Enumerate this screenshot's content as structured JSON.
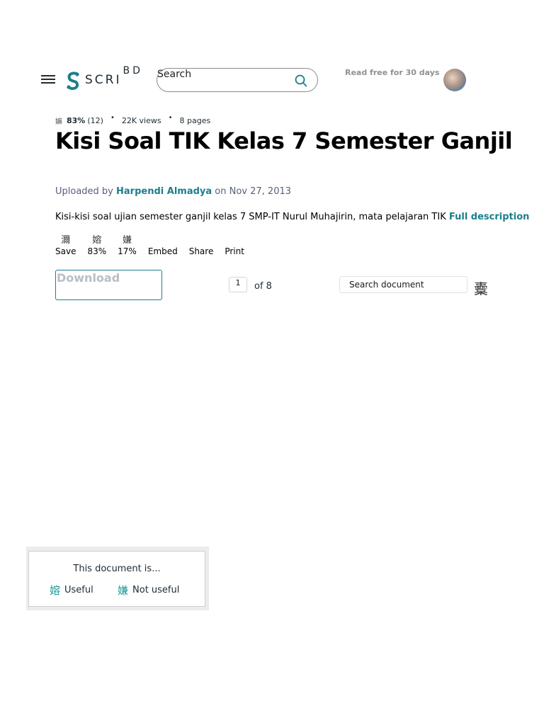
{
  "header": {
    "logo_text": "SCRI",
    "logo_sup": "BD",
    "search_placeholder": "Search",
    "read_free": "Read free for 30 days"
  },
  "meta": {
    "rating_icon": "嫲",
    "rating_pct": "83%",
    "rating_count": "(12)",
    "views": "22K views",
    "pages": "8 pages"
  },
  "document": {
    "title": "Kisi Soal TIK Kelas 7 Semester Ganjil",
    "uploaded_prefix": "Uploaded by",
    "author": "Harpendi Almadya",
    "uploaded_date": "on Nov 27, 2013",
    "description": "Kisi-kisi soal ujian semester ganjil kelas 7 SMP-IT Nurul Muhajirin, mata pelajaran TIK",
    "full_description": "Full description"
  },
  "actions": [
    {
      "glyph": "濔",
      "label": "Save"
    },
    {
      "glyph": "嫆",
      "label": "83%"
    },
    {
      "glyph": "嫌",
      "label": "17%"
    },
    {
      "glyph": "",
      "label": "Embed"
    },
    {
      "glyph": "",
      "label": "Share"
    },
    {
      "glyph": "",
      "label": "Print"
    }
  ],
  "toolbar": {
    "download_label": "Download",
    "page_current": "1",
    "page_of": "of 8",
    "search_document_placeholder": "Search document",
    "fullscreen_glyph": "櫜"
  },
  "feedback": {
    "title": "This document is...",
    "useful_glyph": "嫆",
    "useful_label": "Useful",
    "not_useful_glyph": "嫌",
    "not_useful_label": "Not useful"
  },
  "colors": {
    "accent": "#1b7f8c",
    "text_dark": "#1e2b33",
    "muted": "#8d9296"
  }
}
